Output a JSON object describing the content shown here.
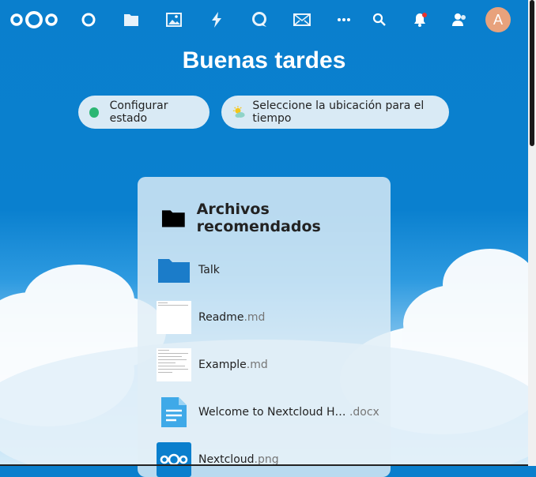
{
  "app": {
    "greeting": "Buenas tardes",
    "avatar_initial": "A"
  },
  "nav": {
    "items": [
      {
        "name": "dashboard-icon"
      },
      {
        "name": "files-icon"
      },
      {
        "name": "photos-icon"
      },
      {
        "name": "activity-icon"
      },
      {
        "name": "talk-icon"
      },
      {
        "name": "mail-icon"
      },
      {
        "name": "more-apps-icon"
      }
    ],
    "right": [
      "search-icon",
      "notifications-icon",
      "contacts-icon"
    ]
  },
  "pills": {
    "status_label": "Configurar estado",
    "weather_label": "Seleccione la ubicación para el tiempo"
  },
  "recommended": {
    "title": "Archivos recomendados",
    "files": [
      {
        "base": "Talk",
        "ext": "",
        "type": "folder"
      },
      {
        "base": "Readme",
        "ext": ".md",
        "type": "doc"
      },
      {
        "base": "Example",
        "ext": ".md",
        "type": "doc"
      },
      {
        "base": "Welcome to Nextcloud H…",
        "ext": " .docx",
        "type": "docx"
      },
      {
        "base": "Nextcloud",
        "ext": ".png",
        "type": "image"
      }
    ]
  },
  "colors": {
    "background": "#0a7fcd",
    "status_online": "#2bb673",
    "avatar": "#e8a27c",
    "folder": "#1b7cc9",
    "notification_dot": "#e9322d"
  }
}
